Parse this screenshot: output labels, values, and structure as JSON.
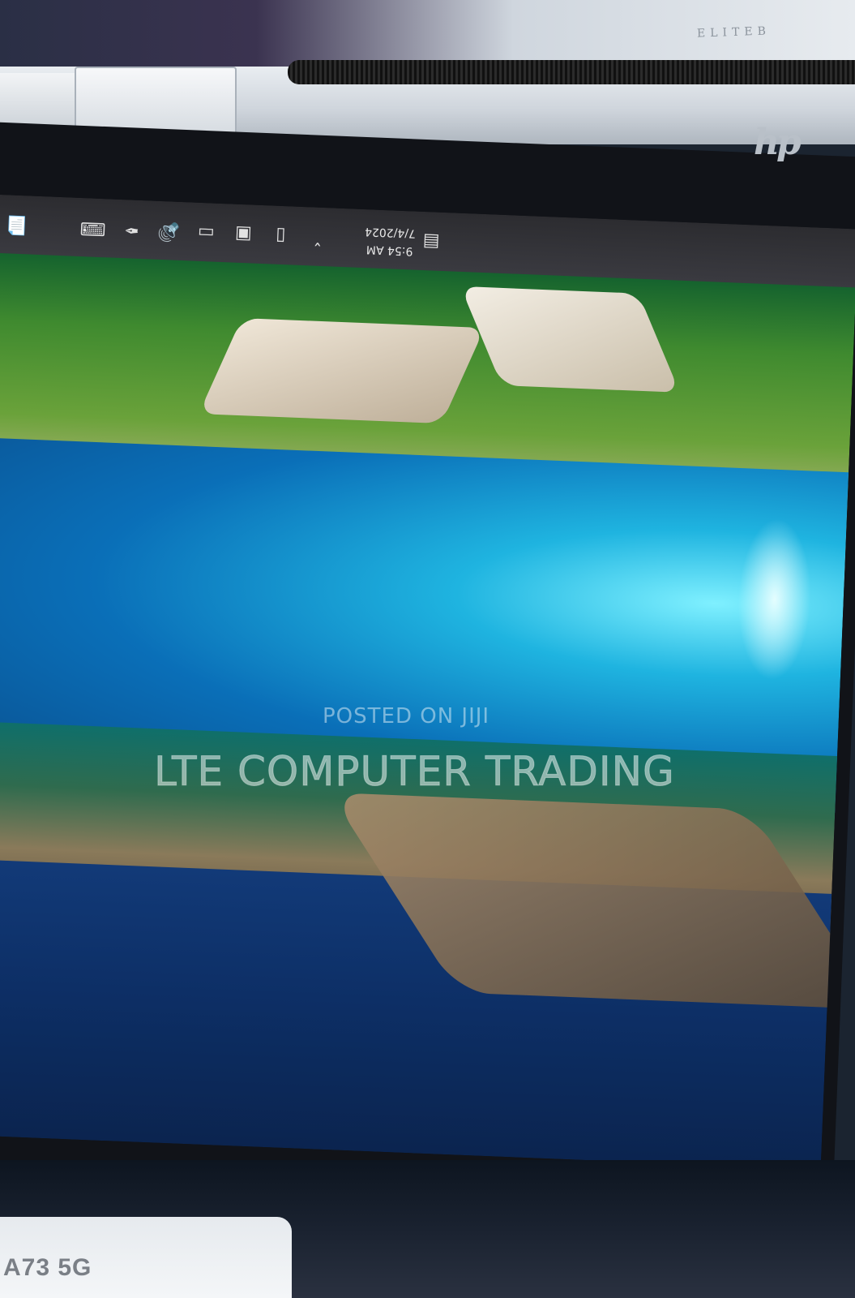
{
  "laptop": {
    "brand_text": "ELITEB",
    "logo_text": "hp"
  },
  "taskbar": {
    "time": "9:54 AM",
    "date": "7/4/2024",
    "icons": [
      "notification-icon",
      "keyboard-icon",
      "pen-icon",
      "volume-icon",
      "battery-icon",
      "app-icon",
      "phone-icon",
      "chevron-up-icon",
      "display-icon"
    ]
  },
  "watermark": {
    "posted": "POSTED ON JIJI",
    "seller": "LTE COMPUTER TRADING"
  },
  "phone": {
    "model": "A73 5G"
  }
}
